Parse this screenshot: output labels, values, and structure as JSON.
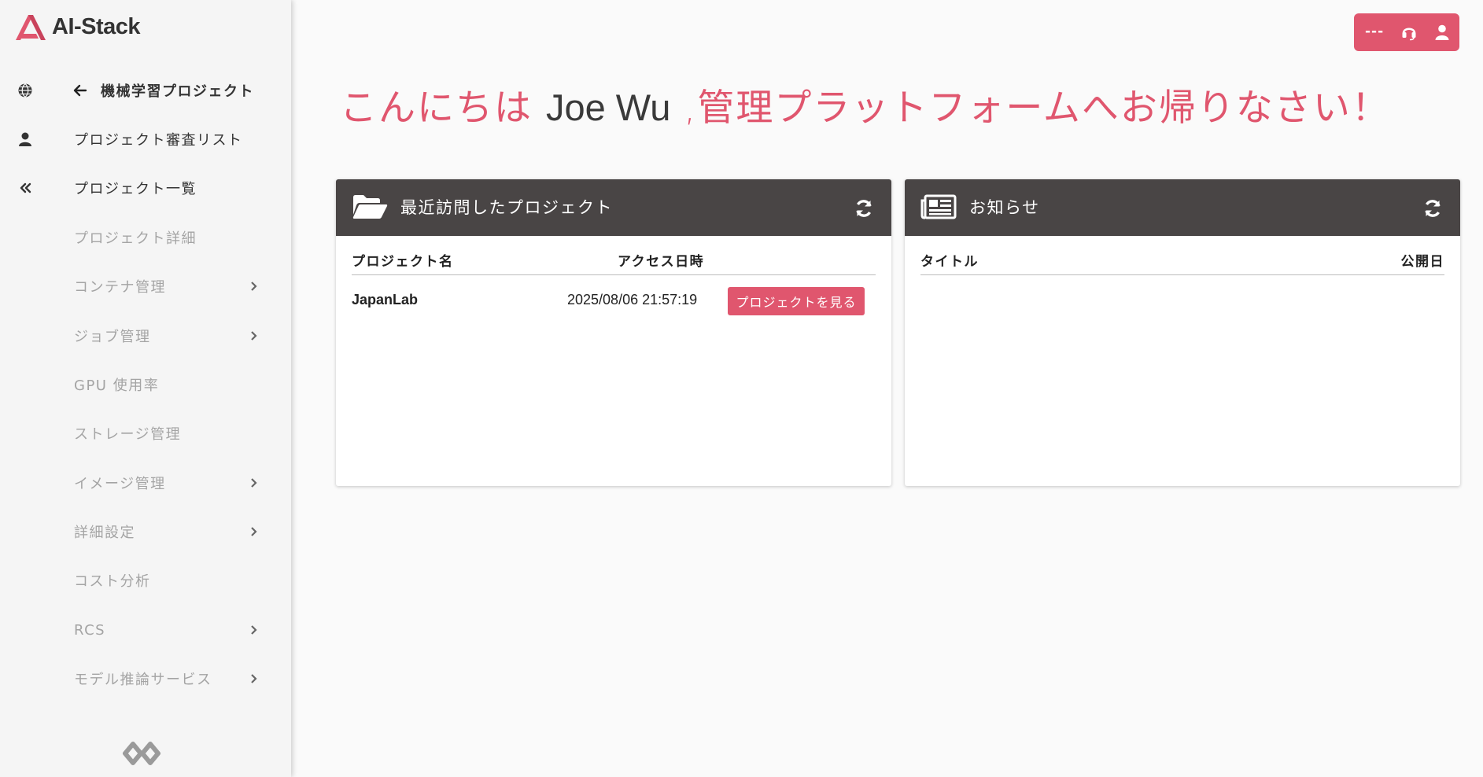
{
  "app": {
    "name": "AI-Stack"
  },
  "sidebar": {
    "items": [
      {
        "label": "機械学習プロジェクト",
        "icon": "globe-icon"
      },
      {
        "label": "プロジェクト審査リスト",
        "icon": "user-icon"
      },
      {
        "label": "プロジェクト一覧",
        "icon": "double-chevron-left-icon"
      },
      {
        "label": "プロジェクト詳細"
      },
      {
        "label": "コンテナ管理"
      },
      {
        "label": "ジョブ管理"
      },
      {
        "label": "GPU 使用率"
      },
      {
        "label": "ストレージ管理"
      },
      {
        "label": "イメージ管理"
      },
      {
        "label": "詳細設定"
      },
      {
        "label": "コスト分析"
      },
      {
        "label": "RCS"
      },
      {
        "label": "モデル推論サービス"
      }
    ]
  },
  "header": {
    "status_text": "---",
    "icons": [
      "headset-icon",
      "user-icon"
    ]
  },
  "greeting": {
    "prefix": "こんにちは ",
    "user": "Joe Wu",
    "suffix": " ,管理プラットフォームへお帰りなさい！"
  },
  "recent_projects": {
    "title": "最近訪問したプロジェクト",
    "columns": [
      "プロジェクト名",
      "アクセス日時"
    ],
    "rows": [
      {
        "name": "JapanLab",
        "accessed": "2025/08/06 21:57:19",
        "action": "プロジェクトを見る"
      }
    ]
  },
  "notices": {
    "title": "お知らせ",
    "columns": [
      "タイトル",
      "公開日"
    ],
    "rows": []
  },
  "colors": {
    "accent": "#e0566e",
    "header_bg": "#494545",
    "sidebar_bg": "#f5f5f5",
    "page_bg": "#fafafa"
  }
}
